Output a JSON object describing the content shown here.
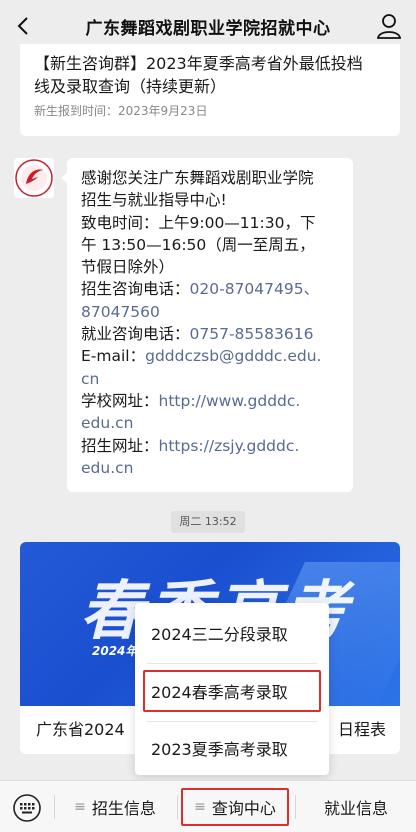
{
  "header": {
    "title": "广东舞蹈戏剧职业学院招就中心"
  },
  "article_card": {
    "title_line1": "【新生咨询群】2023年夏季高考省外最低投档",
    "title_line2": "线及录取查询（持续更新）",
    "date": "新生报到时间：2023年9月23日"
  },
  "welcome_message": {
    "line1": "感谢您关注广东舞蹈戏剧职业学院",
    "line2": "招生与就业指导中心!",
    "line3": "致电时间：上午9:00—11:30，下",
    "line4": "午 13:50—16:50（周一至周五，",
    "line5": "节假日除外）",
    "line6_prefix": "招生咨询电话：",
    "line6_phone": "020-87047495、",
    "line7_phone": "87047560",
    "line8_prefix": "就业咨询电话：",
    "line8_phone": "0757-85583616",
    "line9_prefix": "E-mail：",
    "line9_email": "gdddczsb@gdddc.edu.",
    "line10_email": "cn",
    "line11_prefix": "学校网址：",
    "line11_url": "http://www.gdddc.",
    "line12_url": "edu.cn",
    "line13_prefix": "招生网址：",
    "line13_url": "https://zsjy.gdddc.",
    "line14_url": "edu.cn"
  },
  "timestamp": "周二 13:52",
  "news_card": {
    "banner_text": "春季高考",
    "banner_small": "2024年",
    "caption_left": "广东省2024",
    "caption_right": "日程表"
  },
  "popup_menu": {
    "items": [
      "2024三二分段录取",
      "2024春季高考录取",
      "2023夏季高考录取"
    ]
  },
  "bottom_menu": {
    "items": [
      "招生信息",
      "查询中心",
      "就业信息"
    ],
    "burger": "≡"
  },
  "colors": {
    "highlight": "#d92f2f",
    "link": "#576b95",
    "banner": "#2459d6"
  }
}
